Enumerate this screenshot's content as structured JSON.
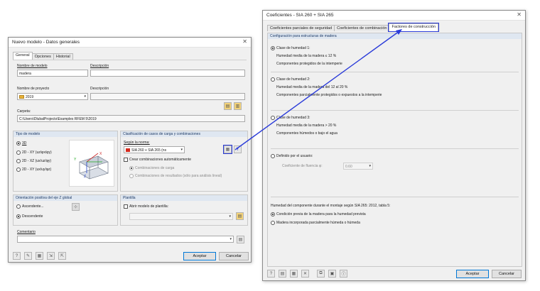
{
  "left_dialog": {
    "title": "Nuevo modelo - Datos generales",
    "close": "✕",
    "tabs": [
      "General",
      "Opciones",
      "Historial"
    ],
    "model_name_label": "Nombre de modelo",
    "description_label": "Descripción",
    "model_name_value": "madera",
    "project_name_label": "Nombre de proyecto",
    "project_value": "2019",
    "folder_label": "Carpeta:",
    "folder_value": "C:\\Users\\DlubalProjects\\Examples RFEM 5\\2019",
    "model_type": {
      "header": "Tipo de modelo",
      "options": [
        "3D",
        "2D - XY (uz/φx/φy)",
        "2D - XZ (ux/uz/φy)",
        "2D - XY (ux/uy/φz)"
      ],
      "selected": 0
    },
    "classification": {
      "header": "Clasificación de casos de carga y combinaciones",
      "according_label": "Según la norma:",
      "norm_value": "SIA 260 + SIA 265 (ns",
      "auto_combo_label": "Crear combinaciones automáticamente",
      "load_combos": "Combinaciones de carga",
      "result_combos": "Combinaciones de resultados (sólo para análisis lineal)"
    },
    "z_orientation": {
      "header": "Orientación positiva del eje Z global",
      "options": [
        "Ascendente...",
        "Descendente"
      ],
      "selected": 1
    },
    "template": {
      "header": "Plantilla",
      "open_label": "Abrir modelo de plantilla:"
    },
    "comment_label": "Comentario",
    "ok": "Aceptar",
    "cancel": "Cancelar"
  },
  "right_dialog": {
    "title": "Coeficientes - SIA 260 + SIA 265",
    "close": "✕",
    "tabs": [
      "Coeficientes parciales de seguridad",
      "Coeficientes de combinación",
      "Factores de construcción"
    ],
    "active_tab": 2,
    "section_header": "Configuración para estructuras de madera",
    "classes": [
      {
        "title": "Clase de humedad 1:",
        "line1": "Humedad media de la madera ≤ 12 %",
        "line2": "Componentes protegidos de la intemperie",
        "selected": true
      },
      {
        "title": "Clase de humedad 2:",
        "line1": "Humedad media de la madera del 12 al 20 %",
        "line2": "Componentes parcialmente protegidos o expuestos a la intemperie",
        "selected": false
      },
      {
        "title": "Clase de humedad 3:",
        "line1": "Humedad media de la madera > 20 %",
        "line2": "Componentes húmedos o bajo el agua",
        "selected": false
      }
    ],
    "user_defined": {
      "label": "Definido por el usuario:",
      "coef_label": "Coeficiente de fluencia φ:",
      "coef_value": "0.60"
    },
    "assembly": {
      "title": "Humedad del componente durante el montaje según SIA 265: 2012, tabla 5:",
      "options": [
        "Condición previa de la madera para la humedad prevista",
        "Madera incorporada parcialmente húmeda o húmeda"
      ],
      "selected": 0
    },
    "ok": "Aceptar",
    "cancel": "Cancelar"
  },
  "colors": {
    "arrow": "#2a3bd9",
    "section_header_bg": "#dfe7f1",
    "section_header_text": "#1d3a66"
  }
}
